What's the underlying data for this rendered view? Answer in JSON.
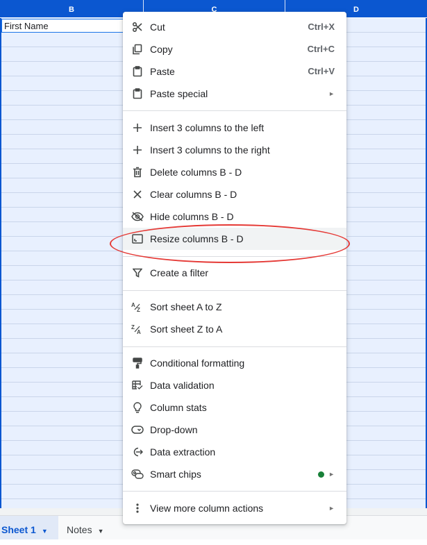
{
  "columns": [
    {
      "letter": "B"
    },
    {
      "letter": "C"
    },
    {
      "letter": "D"
    }
  ],
  "cell": {
    "value": "First Name"
  },
  "menu": {
    "items": {
      "cut": {
        "label": "Cut",
        "shortcut": "Ctrl+X",
        "icon": "scissors-icon"
      },
      "copy": {
        "label": "Copy",
        "shortcut": "Ctrl+C",
        "icon": "copy-icon"
      },
      "paste": {
        "label": "Paste",
        "shortcut": "Ctrl+V",
        "icon": "clipboard-icon"
      },
      "paste_special": {
        "label": "Paste special",
        "icon": "clipboard-icon",
        "submenu": true
      },
      "insert_left": {
        "label": "Insert 3 columns to the left",
        "icon": "plus-icon"
      },
      "insert_right": {
        "label": "Insert 3 columns to the right",
        "icon": "plus-icon"
      },
      "delete_cols": {
        "label": "Delete columns B - D",
        "icon": "trash-icon"
      },
      "clear_cols": {
        "label": "Clear columns B - D",
        "icon": "close-icon"
      },
      "hide_cols": {
        "label": "Hide columns B - D",
        "icon": "eye-off-icon"
      },
      "resize_cols": {
        "label": "Resize columns B - D",
        "icon": "resize-icon"
      },
      "create_filter": {
        "label": "Create a filter",
        "icon": "filter-icon"
      },
      "sort_az": {
        "label": "Sort sheet A to Z",
        "icon": "sort-az-icon"
      },
      "sort_za": {
        "label": "Sort sheet Z to A",
        "icon": "sort-za-icon"
      },
      "cond_format": {
        "label": "Conditional formatting",
        "icon": "paint-roller-icon"
      },
      "data_validation": {
        "label": "Data validation",
        "icon": "table-check-icon"
      },
      "column_stats": {
        "label": "Column stats",
        "icon": "lightbulb-icon"
      },
      "dropdown": {
        "label": "Drop-down",
        "icon": "dropdown-chip-icon"
      },
      "data_extraction": {
        "label": "Data extraction",
        "icon": "extract-icon"
      },
      "smart_chips": {
        "label": "Smart chips",
        "icon": "smart-chip-icon",
        "submenu": true
      },
      "more_actions": {
        "label": "View more column actions",
        "icon": "more-vert-icon",
        "submenu": true
      }
    }
  },
  "sheet_tabs": [
    {
      "label": "Sheet 1",
      "active": true
    },
    {
      "label": "Notes",
      "active": false
    }
  ],
  "colors": {
    "accent": "#0b57d0",
    "selection": "#e8f0fe",
    "annotation": "#e53935",
    "chip_dot": "#188038"
  }
}
